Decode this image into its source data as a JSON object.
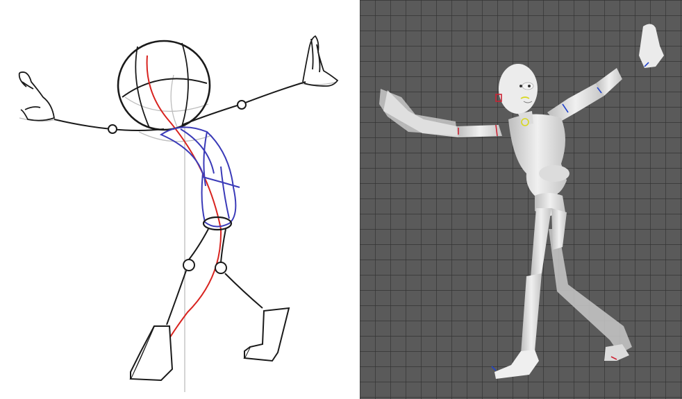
{
  "panels": {
    "left": {
      "kind": "pencil-sketch",
      "subject": "gesture-drawing-figure"
    },
    "right": {
      "kind": "3d-viewport",
      "subject": "posed-mannequin-rig"
    }
  },
  "colors": {
    "sketch_background": "#ffffff",
    "sketch_line": "#1a1a1a",
    "sketch_construction": "#b8b8b8",
    "line_of_action": "#d8231f",
    "torso_construction": "#3a3ab8",
    "viewport_background": "#5a5a5a",
    "viewport_grid": "#333333",
    "mannequin": "#e6e6e6",
    "ghost_pose": "#c9c9c9",
    "rig_marker_red": "#cc2233",
    "rig_marker_blue": "#2244cc",
    "rig_marker_yellow": "#d8d820"
  },
  "icons": [
    "head-circle",
    "joint-circle",
    "hand-glove",
    "foot-box"
  ]
}
